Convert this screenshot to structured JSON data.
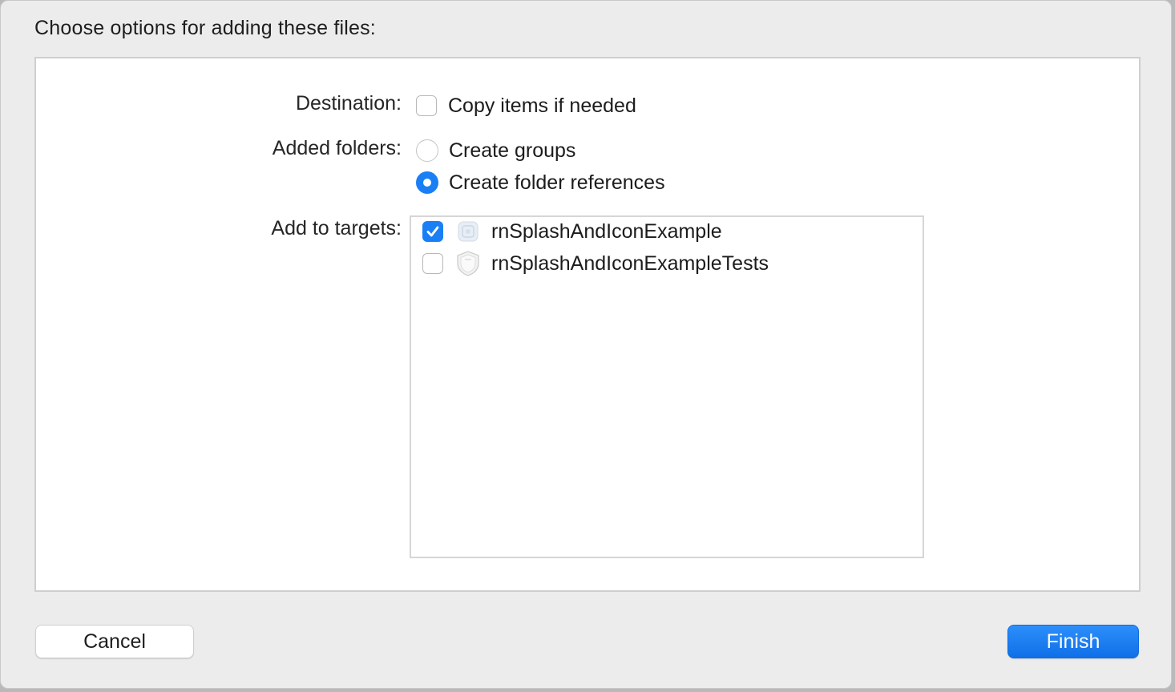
{
  "dialog": {
    "heading": "Choose options for adding these files:"
  },
  "destination": {
    "label": "Destination:",
    "copy_items": {
      "label": "Copy items if needed",
      "checked": false
    }
  },
  "added_folders": {
    "label": "Added folders:",
    "options": [
      {
        "label": "Create groups",
        "selected": false
      },
      {
        "label": "Create folder references",
        "selected": true
      }
    ]
  },
  "targets": {
    "label": "Add to targets:",
    "items": [
      {
        "label": "rnSplashAndIconExample",
        "checked": true,
        "icon": "app-target-icon"
      },
      {
        "label": "rnSplashAndIconExampleTests",
        "checked": false,
        "icon": "test-shield-icon"
      }
    ]
  },
  "buttons": {
    "cancel": "Cancel",
    "finish": "Finish"
  },
  "colors": {
    "accent": "#1a7ff5",
    "panel_bg": "#ffffff",
    "window_bg": "#ececec"
  }
}
